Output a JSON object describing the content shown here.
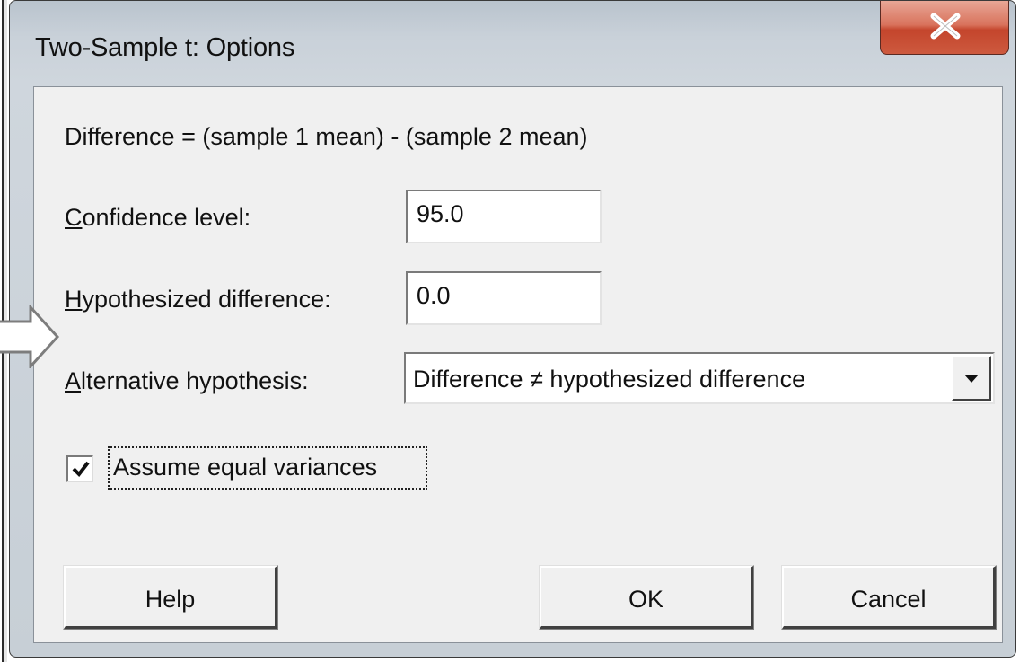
{
  "window": {
    "title": "Two-Sample t: Options",
    "close_glyph": "X"
  },
  "form": {
    "description": "Difference = (sample 1 mean) - (sample 2 mean)",
    "confidence_label": "Confidence level:",
    "confidence_value": "95.0",
    "hypothesized_label": "Hypothesized difference:",
    "hypothesized_value": "0.0",
    "alternative_label": "Alternative hypothesis:",
    "alternative_selected": "Difference ≠ hypothesized difference",
    "equal_variances_label": "Assume equal variances",
    "equal_variances_checked": true
  },
  "buttons": {
    "help": "Help",
    "ok": "OK",
    "cancel": "Cancel"
  },
  "icons": {
    "close": "close-icon",
    "dropdown": "chevron-down-icon",
    "check": "checkmark-icon",
    "pointer": "arrow-right-icon"
  },
  "colors": {
    "dialog_bg": "#f0f0f0",
    "close_button": "#c4452c",
    "title_frame": "#c9d1d9"
  }
}
